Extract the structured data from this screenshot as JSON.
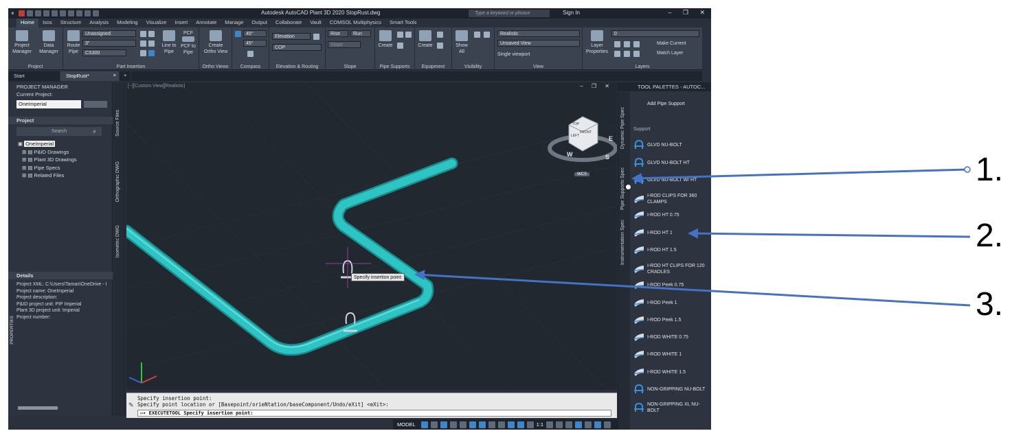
{
  "title_bar": {
    "title": "Autodesk AutoCAD Plant 3D 2020   StopRust.dwg",
    "search_placeholder": "Type a keyword or phrase",
    "sign_in": "Sign In"
  },
  "menu_tabs": [
    "Home",
    "Isos",
    "Structure",
    "Analysis",
    "Modeling",
    "Visualize",
    "Insert",
    "Annotate",
    "Manage",
    "Output",
    "Collaborate",
    "Vault",
    "COMSOL Multiphysics",
    "Smart Tools"
  ],
  "ribbon": {
    "project": {
      "btn1": "Project Manager",
      "btn2": "Data Manager",
      "panel": "Project"
    },
    "part_insertion": {
      "route_pipe": "Route Pipe",
      "combo1": "Unassigned",
      "combo2": "3\"",
      "combo3": "CS300",
      "line_to_pipe": "Line to Pipe",
      "pcf_to_pipe": "PCF to Pipe",
      "pcf_label": "PCF",
      "panel": "Part Insertion"
    },
    "ortho": {
      "btn": "Create Ortho View",
      "panel": "Ortho Views"
    },
    "compass": {
      "angle1": "45°",
      "angle2": "45°",
      "panel": "Compass"
    },
    "elevation": {
      "field": "Elevation",
      "cop": "COP",
      "panel": "Elevation & Routing"
    },
    "slope": {
      "rise": "Rise",
      "run": "Run",
      "slope": "Slope",
      "panel": "Slope"
    },
    "pipe_supports": {
      "btn": "Create",
      "panel": "Pipe Supports"
    },
    "equipment": {
      "btn": "Create",
      "panel": "Equipment"
    },
    "visibility": {
      "btn": "Show All",
      "panel": "Visibility"
    },
    "view": {
      "style": "Realistic",
      "saved": "Unsaved View",
      "viewport": "Single viewport",
      "panel": "View"
    },
    "layers": {
      "properties": "Layer Properties",
      "layer": "0",
      "make_current": "Make Current",
      "match_layer": "Match Layer",
      "panel": "Layers"
    }
  },
  "doc_tabs": [
    "Start",
    "StopRust*"
  ],
  "project_manager": {
    "header": "PROJECT MANAGER",
    "current_project_label": "Current Project:",
    "current_project": "OneImperial",
    "project_label": "Project",
    "search": "Search",
    "tree": [
      "OneImperial",
      "P&ID Drawings",
      "Plant 3D Drawings",
      "Pipe Specs",
      "Related Files"
    ],
    "details_header": "Details",
    "details": [
      "Project XML: C:\\Users\\Tamas\\OneDrive - I",
      "Project name: OneImperial",
      "Project description:",
      "P&ID project unit: PIP Imperial",
      "Plant 3D project unit: Imperial",
      "Project number:"
    ],
    "vertical_tabs": [
      "Source Files",
      "Orthographic DWG",
      "Isometric DWG"
    ],
    "properties_tab": "PROPERTIES"
  },
  "viewport": {
    "label": "[−][Custom View][Realistic]",
    "tooltip": "Specify insertion point:",
    "wcs": "WCS",
    "viewcube": {
      "top": "TOP",
      "front": "FRONT",
      "left": "LEFT",
      "south": "S",
      "west": "W",
      "east": "E"
    }
  },
  "command": {
    "line1": "Specify insertion point:",
    "line2": "Specify point location or [Basepoint/orieNtation/baseComponent/Undo/eXit] <eXit>:",
    "input": "EXECUTETOOL Specify insertion point:"
  },
  "status": {
    "model": "MODEL",
    "scale": "1:1"
  },
  "tool_palette": {
    "title": "TOOL PALETTES - AUTOC...",
    "side_tabs": [
      "Dynamic Pipe Spec",
      "Pipe Supports Spec",
      "Instrumentation Spec"
    ],
    "add_support": "Add Pipe Support",
    "section": "Support",
    "items": [
      "GLVD NU-BOLT",
      "GLVD NU-BOLT HT",
      "GLVD NU-BOLT W/ HT",
      "I-ROD CLIPS FOR 360 CLAMPS",
      "I-ROD HT 0.75",
      "I-ROD HT 1",
      "I-ROD HT 1.5",
      "I-ROD HT CLIPS FOR 120 CRADLES",
      "I-ROD Peek 0.75",
      "I-ROD Peek 1",
      "I-ROD Peek 1.5",
      "I-ROD WHITE 0.75",
      "I-ROD WHITE 1",
      "I-ROD WHITE 1.5",
      "NON-GRIPPING NU-BOLT",
      "NON-GRIPPING XL NU-BOLT"
    ]
  },
  "annotations": [
    "1.",
    "2.",
    "3."
  ],
  "colors": {
    "pipe": "#2ec4c4",
    "arrow": "#4472c4",
    "background": "#212830",
    "ribbon": "#3b4350"
  }
}
